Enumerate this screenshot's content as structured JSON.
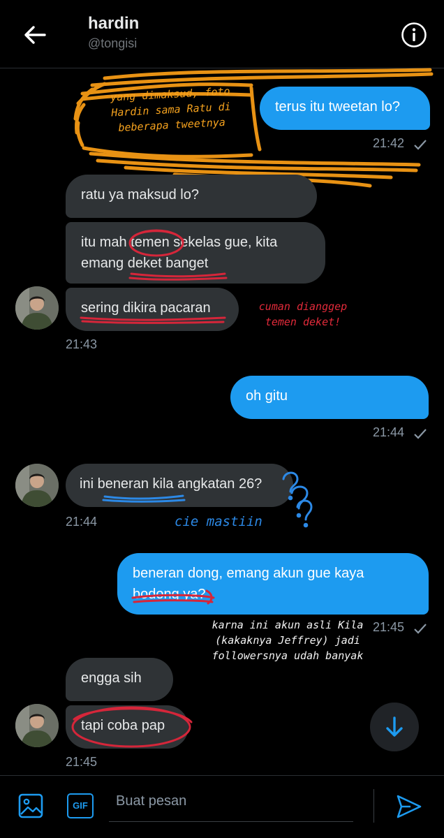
{
  "header": {
    "name": "hardin",
    "handle": "@tongisi"
  },
  "messages": {
    "m1": {
      "text": "terus itu tweetan lo?",
      "time": "21:42"
    },
    "m2": {
      "text": "ratu ya maksud lo?"
    },
    "m3": {
      "text": "itu mah temen sekelas gue, kita emang deket banget"
    },
    "m4": {
      "text": "sering dikira pacaran",
      "time": "21:43"
    },
    "m5": {
      "text": "oh gitu",
      "time": "21:44"
    },
    "m6": {
      "text": "ini beneran kila angkatan 26?",
      "time": "21:44"
    },
    "m7": {
      "text": "beneran dong, emang akun gue kaya bodong ya?",
      "time": "21:45"
    },
    "m8": {
      "text": "engga sih"
    },
    "m9": {
      "text": "tapi coba pap",
      "time": "21:45"
    }
  },
  "annotations": {
    "orange": "yang dimaksud, foto Hardin sama Ratu di beberapa tweetnya",
    "red": "cuman dianggep temen deket!",
    "blue": "cie mastiin",
    "white": "karna ini akun asli Kila (kakaknya Jeffrey) jadi followersnya udah banyak"
  },
  "composer": {
    "placeholder": "Buat pesan",
    "gif_label": "GIF"
  },
  "colors": {
    "background": "#000000",
    "bubble_in": "#2f3336",
    "bubble_out": "#1d9bf0",
    "accent": "#1d9bf0",
    "annotation_orange": "#f5a21e",
    "annotation_red": "#e22a3a",
    "annotation_blue": "#2c89e6"
  }
}
